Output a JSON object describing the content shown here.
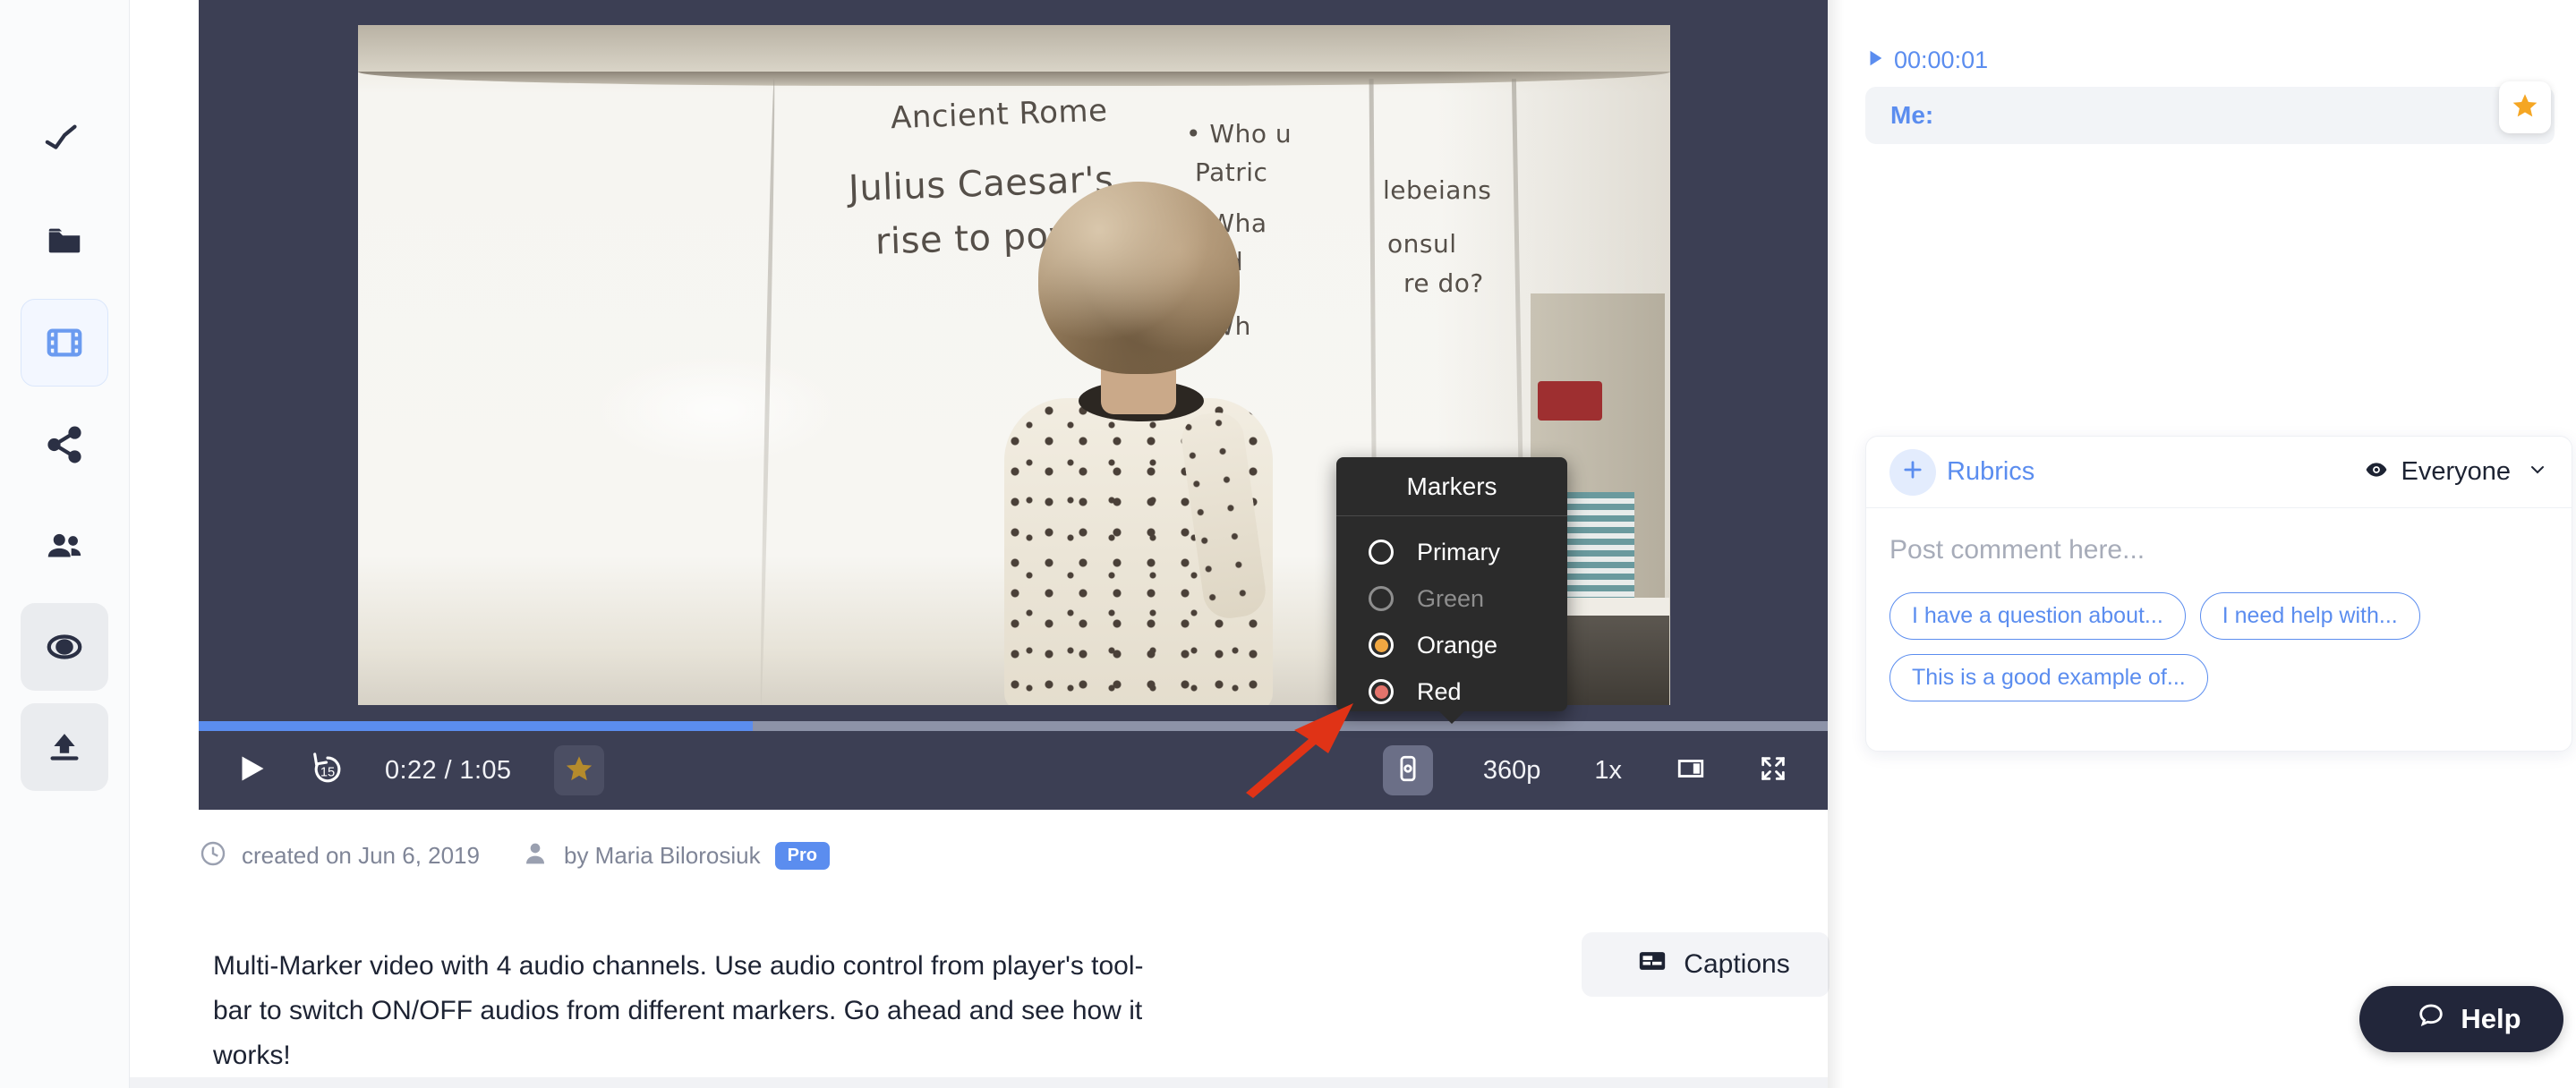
{
  "sidebar": {
    "items": [
      {
        "name": "analytics",
        "icon": "analytics-icon",
        "state": "default"
      },
      {
        "name": "folder",
        "icon": "folder-icon",
        "state": "default"
      },
      {
        "name": "videos",
        "icon": "film-icon",
        "state": "active"
      },
      {
        "name": "share",
        "icon": "share-icon",
        "state": "default"
      },
      {
        "name": "people",
        "icon": "people-icon",
        "state": "default"
      },
      {
        "name": "record",
        "icon": "record-icon",
        "state": "grey"
      },
      {
        "name": "upload",
        "icon": "upload-icon",
        "state": "grey"
      }
    ]
  },
  "player": {
    "current_time": "0:22",
    "total_time": "1:05",
    "time_display": "0:22 / 1:05",
    "progress_percent": 34,
    "resolution": "360p",
    "speed": "1x",
    "rewind_seconds": "15",
    "buttons": {
      "play": "play-icon",
      "rewind": "rewind-15-icon",
      "star": "star-icon",
      "audio": "audio-markers-icon",
      "theater": "theater-mode-icon",
      "fullscreen": "fullscreen-icon"
    }
  },
  "markers_popup": {
    "title": "Markers",
    "options": [
      {
        "label": "Primary",
        "color": "#2b2b2b",
        "selected": false,
        "enabled": true
      },
      {
        "label": "Green",
        "color": "#2b2b2b",
        "selected": false,
        "enabled": false
      },
      {
        "label": "Orange",
        "color": "#f0a742",
        "selected": true,
        "enabled": true
      },
      {
        "label": "Red",
        "color": "#e4746c",
        "selected": true,
        "enabled": true
      }
    ]
  },
  "video_scene": {
    "whiteboard_title": "Ancient Rome",
    "whiteboard_line2": "Julius Caesar's",
    "whiteboard_line3": "rise to power",
    "bullet_1a": "• Who u",
    "bullet_1b": "Patric",
    "bullet_1c": "lebeians",
    "bullet_2a": "• Wha",
    "bullet_2b": "and",
    "bullet_2c": "onsul",
    "bullet_2d": "re do?",
    "bullet_3a": "• Wh"
  },
  "meta": {
    "created_label": "created on Jun 6, 2019",
    "author_label": "by Maria Bilorosiuk",
    "badge": "Pro",
    "clock_icon": "clock-icon",
    "person_icon": "person-icon"
  },
  "description": "Multi-Marker video with 4 audio channels. Use audio control from player's tool-bar to switch ON/OFF audios from different markers. Go ahead and see how it works!",
  "captions_button": {
    "label": "Captions",
    "icon": "captions-icon"
  },
  "comments": {
    "items": [
      {
        "timestamp": "00:00:01",
        "author": "Me:",
        "body": "",
        "starred": true
      }
    ]
  },
  "compose": {
    "rubrics_label": "Rubrics",
    "plus_icon": "plus-icon",
    "visibility_label": "Everyone",
    "visibility_icon": "eye-icon",
    "chevron_icon": "chevron-down-icon",
    "placeholder": "Post comment here...",
    "chips": [
      "I have a question about...",
      "I need help with...",
      "This is a good example of..."
    ]
  },
  "help": {
    "label": "Help",
    "icon": "chat-bubble-icon"
  },
  "colors": {
    "accent_blue": "#5b8def",
    "player_bg": "#3c3f54",
    "popup_bg": "#2b2b2b",
    "star_gold": "#b58b2c",
    "arrow_red": "#e03316",
    "marker_orange": "#f0a742",
    "marker_red": "#e4746c"
  }
}
